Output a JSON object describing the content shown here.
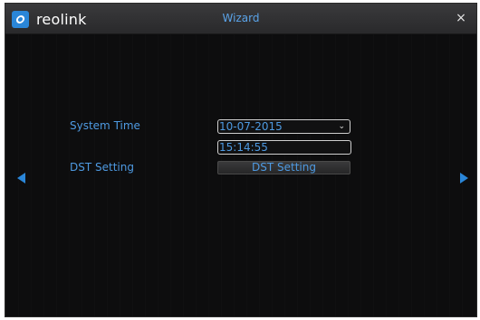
{
  "header": {
    "logo_text": "reolink",
    "title": "Wizard",
    "close_glyph": "×"
  },
  "form": {
    "system_time_label": "System Time",
    "date_value": "10-07-2015",
    "time_value": "15:14:55",
    "dst_label": "DST Setting",
    "dst_button_label": "DST Setting"
  },
  "icons": {
    "logo": "reolink-logo-icon",
    "close": "close-icon",
    "dropdown": "chevron-down-icon",
    "prev": "arrow-left-icon",
    "next": "arrow-right-icon"
  },
  "colors": {
    "accent": "#2a86d8",
    "text_blue": "#4e9ae2",
    "background": "#0d0d0e"
  }
}
